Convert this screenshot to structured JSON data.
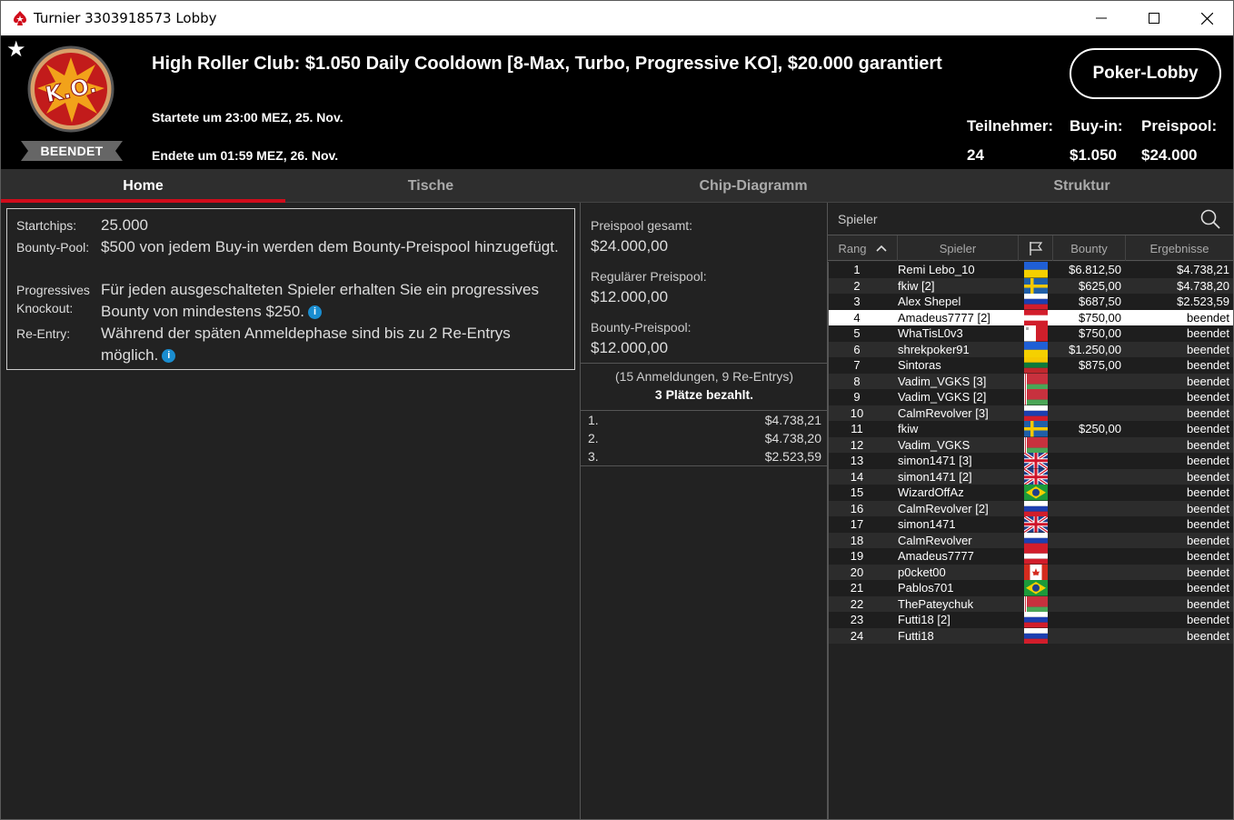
{
  "window": {
    "title": "Turnier 3303918573 Lobby"
  },
  "header": {
    "badge": "BEENDET",
    "tournament_name": "High Roller Club: $1.050 Daily Cooldown [8-Max, Turbo, Progressive KO], $20.000 garantiert",
    "started": "Startete um 23:00 MEZ, 25. Nov.",
    "ended": "Endete um 01:59 MEZ, 26. Nov.",
    "lobby_button": "Poker-Lobby",
    "stats": [
      {
        "label": "Teilnehmer:",
        "value": "24"
      },
      {
        "label": "Buy-in:",
        "value": "$1.050"
      },
      {
        "label": "Preispool:",
        "value": "$24.000"
      }
    ],
    "logo_text": "K.O."
  },
  "tabs": [
    {
      "label": "Home",
      "active": true
    },
    {
      "label": "Tische",
      "active": false
    },
    {
      "label": "Chip-Diagramm",
      "active": false
    },
    {
      "label": "Struktur",
      "active": false
    }
  ],
  "info": {
    "startchips_label": "Startchips:",
    "startchips_value": "25.000",
    "bountypool_label": "Bounty-Pool:",
    "bountypool_value": "$500 von jedem Buy-in werden dem Bounty-Preispool hinzugefügt.",
    "progressive_label": "Progressives",
    "knockout_label": "Knockout:",
    "progressive_value_1": "Für jeden ausgeschalteten Spieler erhalten Sie ein progressives",
    "progressive_value_2": "Bounty von mindestens $250.",
    "reentry_label": "Re-Entry:",
    "reentry_value_1": "Während der späten Anmeldephase sind bis zu 2 Re-Entrys",
    "reentry_value_2": "möglich."
  },
  "prizepool": {
    "total_label": "Preispool gesamt:",
    "total_value": "$24.000,00",
    "regular_label": "Regulärer Preispool:",
    "regular_value": "$12.000,00",
    "bounty_label": "Bounty-Preispool:",
    "bounty_value": "$12.000,00",
    "registrations": "(15 Anmeldungen, 9 Re-Entrys)",
    "paid": "3 Plätze bezahlt.",
    "places": [
      {
        "place": "1.",
        "amount": "$4.738,21"
      },
      {
        "place": "2.",
        "amount": "$4.738,20"
      },
      {
        "place": "3.",
        "amount": "$2.523,59"
      }
    ]
  },
  "players": {
    "search_label": "Spieler",
    "columns": [
      "Rang",
      "Spieler",
      "Bounty",
      "Ergebnisse"
    ],
    "rows": [
      {
        "rank": "1",
        "name": "Remi Lebo_10",
        "flag": "ua",
        "bounty": "$6.812,50",
        "result": "$4.738,21"
      },
      {
        "rank": "2",
        "name": "fkiw [2]",
        "flag": "se",
        "bounty": "$625,00",
        "result": "$4.738,20"
      },
      {
        "rank": "3",
        "name": "Alex Shepel",
        "flag": "ru",
        "bounty": "$687,50",
        "result": "$2.523,59"
      },
      {
        "rank": "4",
        "name": "Amadeus7777 [2]",
        "flag": "at",
        "bounty": "$750,00",
        "result": "beendet",
        "selected": true
      },
      {
        "rank": "5",
        "name": "WhaTisL0v3",
        "flag": "mt",
        "bounty": "$750,00",
        "result": "beendet"
      },
      {
        "rank": "6",
        "name": "shrekpoker91",
        "flag": "ua",
        "bounty": "$1.250,00",
        "result": "beendet"
      },
      {
        "rank": "7",
        "name": "Sintoras",
        "flag": "lt",
        "bounty": "$875,00",
        "result": "beendet"
      },
      {
        "rank": "8",
        "name": "Vadim_VGKS [3]",
        "flag": "by",
        "bounty": "",
        "result": "beendet"
      },
      {
        "rank": "9",
        "name": "Vadim_VGKS [2]",
        "flag": "by",
        "bounty": "",
        "result": "beendet"
      },
      {
        "rank": "10",
        "name": "CalmRevolver [3]",
        "flag": "ru",
        "bounty": "",
        "result": "beendet"
      },
      {
        "rank": "11",
        "name": "fkiw",
        "flag": "se",
        "bounty": "$250,00",
        "result": "beendet"
      },
      {
        "rank": "12",
        "name": "Vadim_VGKS",
        "flag": "by",
        "bounty": "",
        "result": "beendet"
      },
      {
        "rank": "13",
        "name": "simon1471 [3]",
        "flag": "gb",
        "bounty": "",
        "result": "beendet"
      },
      {
        "rank": "14",
        "name": "simon1471 [2]",
        "flag": "gb",
        "bounty": "",
        "result": "beendet"
      },
      {
        "rank": "15",
        "name": "WizardOffAz",
        "flag": "br",
        "bounty": "",
        "result": "beendet"
      },
      {
        "rank": "16",
        "name": "CalmRevolver [2]",
        "flag": "ru",
        "bounty": "",
        "result": "beendet"
      },
      {
        "rank": "17",
        "name": "simon1471",
        "flag": "gb",
        "bounty": "",
        "result": "beendet"
      },
      {
        "rank": "18",
        "name": "CalmRevolver",
        "flag": "ru",
        "bounty": "",
        "result": "beendet"
      },
      {
        "rank": "19",
        "name": "Amadeus7777",
        "flag": "at",
        "bounty": "",
        "result": "beendet"
      },
      {
        "rank": "20",
        "name": "p0cket00",
        "flag": "ca",
        "bounty": "",
        "result": "beendet"
      },
      {
        "rank": "21",
        "name": "Pablos701",
        "flag": "br",
        "bounty": "",
        "result": "beendet"
      },
      {
        "rank": "22",
        "name": "ThePateychuk",
        "flag": "by",
        "bounty": "",
        "result": "beendet"
      },
      {
        "rank": "23",
        "name": "Futti18 [2]",
        "flag": "ru",
        "bounty": "",
        "result": "beendet"
      },
      {
        "rank": "24",
        "name": "Futti18",
        "flag": "ru",
        "bounty": "",
        "result": "beendet"
      }
    ]
  },
  "colors": {
    "accent": "#d00c1b",
    "info": "#1a8dd0"
  }
}
